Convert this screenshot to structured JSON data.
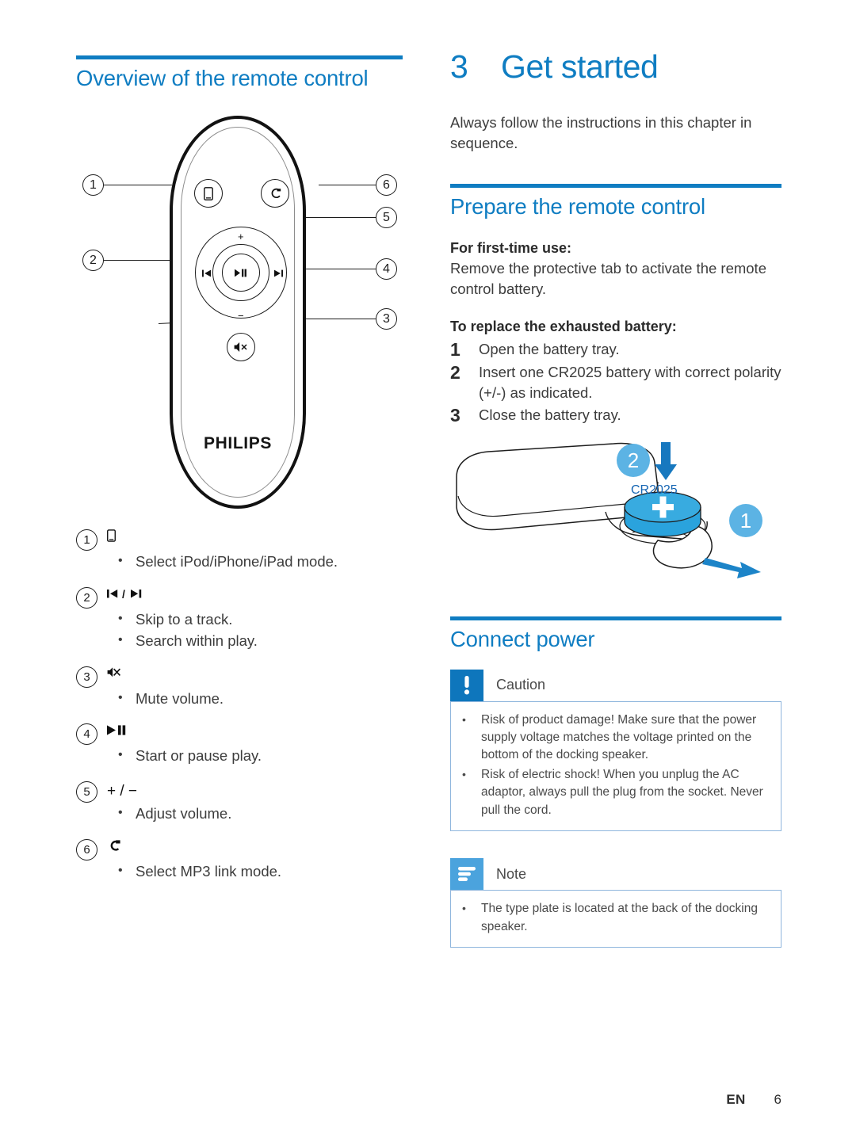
{
  "left": {
    "heading": "Overview of the remote control",
    "remote": {
      "brand": "PHILIPS",
      "callouts": [
        "1",
        "2",
        "3",
        "4",
        "5",
        "6"
      ],
      "wheel": {
        "plus": "+",
        "minus": "−",
        "prev": "⏮",
        "next": "⏭",
        "play_pause": "▶❙❙"
      }
    },
    "legend": [
      {
        "num": "1",
        "key": "⎕",
        "key_kind": "icon-ipod",
        "bullets": [
          "Select iPod/iPhone/iPad mode."
        ]
      },
      {
        "num": "2",
        "key": "⏮ / ⏭",
        "key_kind": "icon-skip",
        "bullets": [
          "Skip to a track.",
          "Search within play."
        ]
      },
      {
        "num": "3",
        "key": "🔇",
        "key_kind": "icon-mute",
        "bullets": [
          "Mute volume."
        ]
      },
      {
        "num": "4",
        "key": "▶❙❙",
        "key_kind": "icon-playpause",
        "bullets": [
          "Start or pause play."
        ]
      },
      {
        "num": "5",
        "key": "+ / −",
        "key_kind": "text",
        "bullets": [
          "Adjust volume."
        ]
      },
      {
        "num": "6",
        "key": "↵",
        "key_kind": "icon-mp3link",
        "bullets": [
          "Select MP3 link mode."
        ]
      }
    ]
  },
  "right": {
    "chapter_number": "3",
    "chapter_title": "Get started",
    "intro": "Always follow the instructions in this chapter in sequence.",
    "prepare": {
      "heading": "Prepare the remote control",
      "first_time_label": "For first-time use:",
      "first_time_text": "Remove the protective tab to activate the remote control battery.",
      "replace_label": "To replace the exhausted battery:",
      "steps": [
        {
          "n": "1",
          "text": "Open the battery tray."
        },
        {
          "n": "2",
          "text": "Insert one CR2025 battery with correct polarity (+/-) as indicated."
        },
        {
          "n": "3",
          "text": "Close the battery tray."
        }
      ],
      "figure": {
        "badge_step2": "2",
        "badge_step1": "1",
        "battery_label": "CR2025",
        "battery_polarity": "+"
      }
    },
    "connect": {
      "heading": "Connect power",
      "caution": {
        "title": "Caution",
        "icon": "exclamation-icon",
        "items": [
          "Risk of product damage! Make sure that the power supply voltage matches the voltage printed on the bottom of the docking speaker.",
          "Risk of electric shock! When you unplug the AC adaptor, always pull the plug from the socket. Never pull the cord."
        ]
      },
      "note": {
        "title": "Note",
        "icon": "note-lines-icon",
        "items": [
          "The type plate is located at the back of the docking speaker."
        ]
      }
    }
  },
  "footer": {
    "language": "EN",
    "page": "6"
  },
  "colors": {
    "accent": "#0f7dc2",
    "accent_light": "#5cb3e4",
    "note_icon": "#4ba3dd",
    "caution_icon": "#0e76bc",
    "box_border": "#8fb6dd",
    "body_text": "#3c3c3c"
  }
}
